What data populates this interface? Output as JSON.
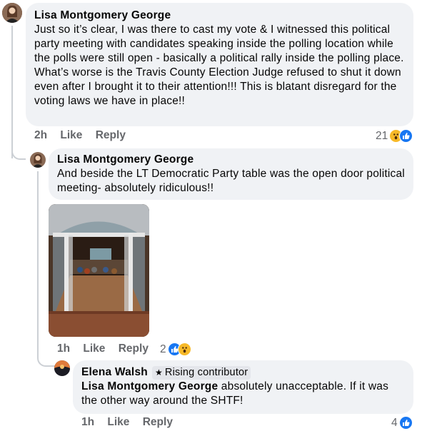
{
  "comment1": {
    "author": "Lisa Montgomery George",
    "text": "Just so it’s clear, I was there to cast my vote & I witnessed this political party meeting with candidates speaking inside the polling location while the polls were still open - basically a political rally inside the polling place. What’s worse is the Travis County Election Judge refused to shut it down even after I brought it to their attention!!! This is blatant disregard for the voting laws we have in place!!",
    "time": "2h",
    "like": "Like",
    "reply": "Reply",
    "reactions": "21",
    "reaction_icons": [
      "wow-icon",
      "like-icon"
    ]
  },
  "comment2": {
    "author": "Lisa Montgomery George",
    "text": "And beside the LT Democratic Party table was the open door political meeting- absolutely ridiculous!!",
    "time": "1h",
    "like": "Like",
    "reply": "Reply",
    "reactions": "2",
    "reaction_icons": [
      "like-icon",
      "wow-icon"
    ]
  },
  "comment3": {
    "author": "Elena Walsh",
    "badge": "Rising contributor",
    "mention": "Lisa Montgomery George",
    "text": " absolutely unacceptable. If it was the other way around the SHTF!",
    "time": "1h",
    "like": "Like",
    "reply": "Reply",
    "reactions": "4",
    "reaction_icons": [
      "like-icon"
    ]
  },
  "colors": {
    "bubble": "#f0f2f5",
    "meta": "#65676b",
    "like_blue": "#1877f2",
    "wow_yellow": "#f7b928"
  }
}
